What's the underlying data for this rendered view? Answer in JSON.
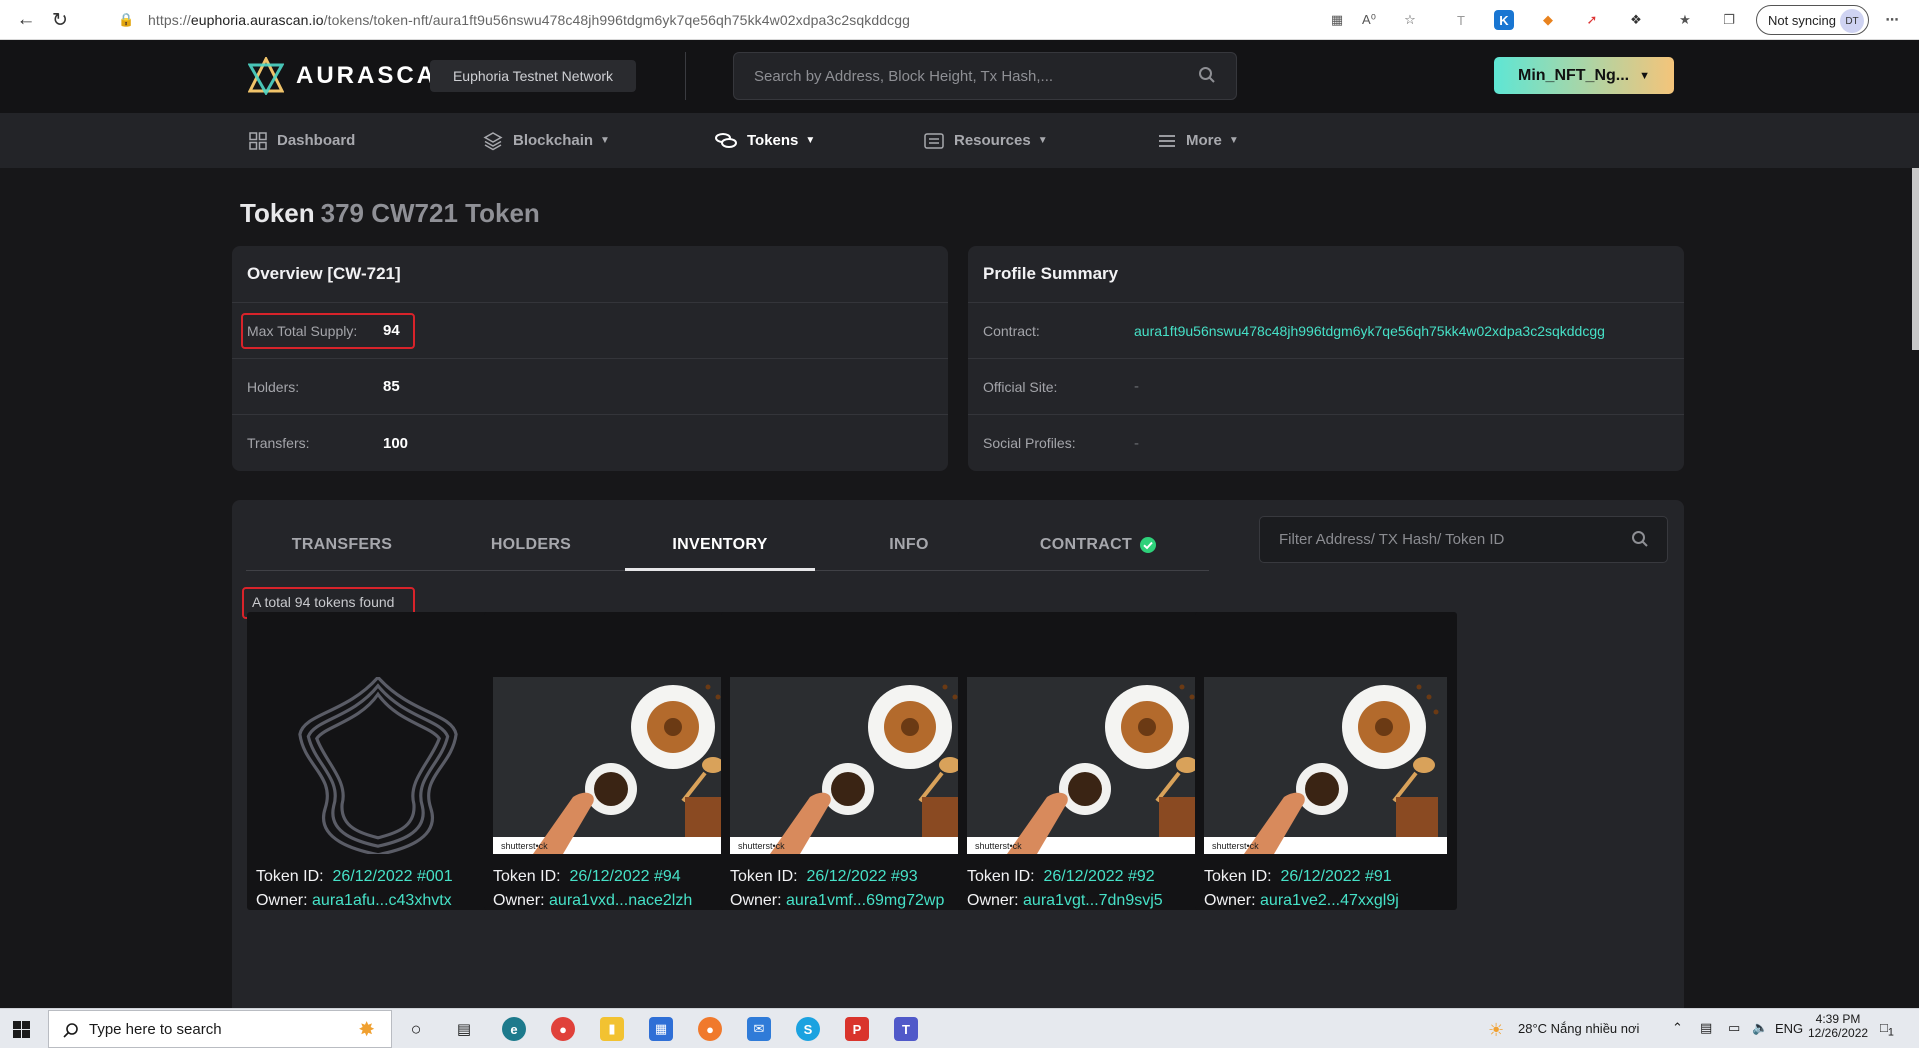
{
  "browser": {
    "url_prefix": "https://",
    "url_host": "euphoria.aurascan.io",
    "url_path": "/tokens/token-nft/aura1ft9u56nswu478c48jh996tdgm6yk7qe56qh75kk4w02xdpa3c2sqkddcgg",
    "sync_label": "Not syncing",
    "profile_initials": "DT"
  },
  "header": {
    "logo_text": "AURASCAN",
    "network": "Euphoria Testnet Network",
    "search_placeholder": "Search by Address, Block Height, Tx Hash,...",
    "wallet_label": "Min_NFT_Ng..."
  },
  "nav": {
    "dashboard": "Dashboard",
    "blockchain": "Blockchain",
    "tokens": "Tokens",
    "resources": "Resources",
    "more": "More"
  },
  "page": {
    "title": "Token",
    "subtitle": "379 CW721 Token"
  },
  "overview": {
    "title": "Overview [CW-721]",
    "max_supply_label": "Max Total Supply:",
    "max_supply_value": "94",
    "holders_label": "Holders:",
    "holders_value": "85",
    "transfers_label": "Transfers:",
    "transfers_value": "100"
  },
  "profile": {
    "title": "Profile Summary",
    "contract_label": "Contract:",
    "contract_value": "aura1ft9u56nswu478c48jh996tdgm6yk7qe56qh75kk4w02xdpa3c2sqkddcgg",
    "site_label": "Official Site:",
    "site_value": "-",
    "social_label": "Social Profiles:",
    "social_value": "-"
  },
  "tabs": {
    "transfers": "TRANSFERS",
    "holders": "HOLDERS",
    "inventory": "INVENTORY",
    "info": "INFO",
    "contract": "CONTRACT",
    "filter_placeholder": "Filter Address/ TX Hash/ Token ID"
  },
  "inventory": {
    "total_text": "A total 94 tokens found",
    "token_id_label": "Token ID:",
    "owner_label": "Owner:",
    "tokens": [
      {
        "id": "26/12/2022 #001",
        "owner": "aura1afu...c43xhvtx",
        "image": "aura-logo"
      },
      {
        "id": "26/12/2022 #94",
        "owner": "aura1vxd...nace2lzh",
        "image": "coffee-photo"
      },
      {
        "id": "26/12/2022 #93",
        "owner": "aura1vmf...69mg72wp",
        "image": "coffee-photo"
      },
      {
        "id": "26/12/2022 #92",
        "owner": "aura1vgt...7dn9svj5",
        "image": "coffee-photo"
      },
      {
        "id": "26/12/2022 #91",
        "owner": "aura1ve2...47xxgl9j",
        "image": "coffee-photo"
      }
    ],
    "watermark": "shutterst•ck"
  },
  "taskbar": {
    "search_placeholder": "Type here to search",
    "weather": "28°C  Nắng nhiều nơi",
    "lang": "ENG",
    "time": "4:39 PM",
    "date": "12/26/2022",
    "notif": "1"
  },
  "colors": {
    "accent": "#46e1c7",
    "highlight": "#d8232a",
    "bg": "#171719"
  }
}
